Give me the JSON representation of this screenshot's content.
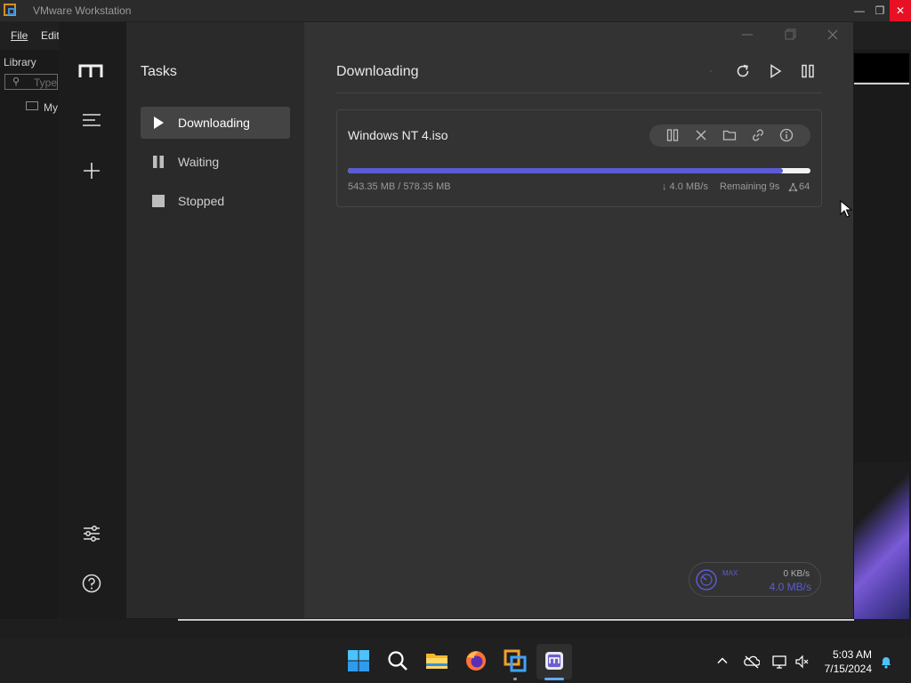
{
  "host": {
    "title": "VMware Workstation",
    "menu": [
      "File",
      "Edit"
    ],
    "library_label": "Library",
    "search_placeholder": "Type",
    "tree_item": "My"
  },
  "app": {
    "sidebar_title": "Tasks",
    "nav": [
      {
        "label": "Downloading",
        "active": true
      },
      {
        "label": "Waiting",
        "active": false
      },
      {
        "label": "Stopped",
        "active": false
      }
    ],
    "page_title": "Downloading",
    "task": {
      "name": "Windows NT 4.iso",
      "size": "543.35 MB / 578.35 MB",
      "progress": 0.94,
      "speed": "↓ 4.0 MB/s",
      "remaining": "Remaining 9s",
      "connections": "64"
    },
    "speedometer": {
      "max_label": "MAX",
      "upload": "0 KB/s",
      "download": "4.0 MB/s"
    },
    "accent": "#5b5bd6"
  },
  "taskbar": {
    "time": "5:03 AM",
    "date": "7/15/2024"
  }
}
